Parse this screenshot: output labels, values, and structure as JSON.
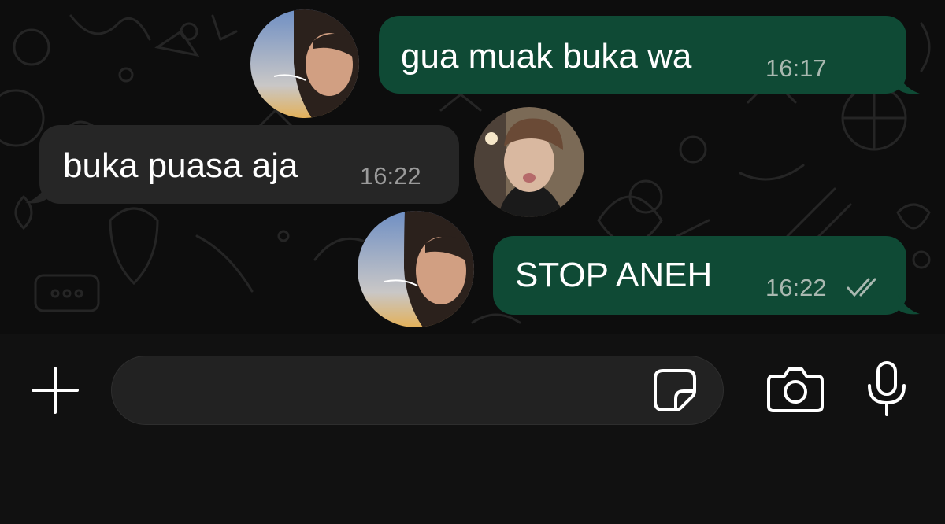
{
  "messages": [
    {
      "direction": "outgoing",
      "text": "gua muak buka wa",
      "time": "16:17",
      "status": "read"
    },
    {
      "direction": "incoming",
      "text": "buka puasa aja",
      "time": "16:22"
    },
    {
      "direction": "outgoing",
      "text": "STOP ANEH",
      "time": "16:22",
      "status": "read"
    }
  ],
  "composer": {
    "input_value": "",
    "plus_icon": "plus-icon",
    "sticker_icon": "sticker-icon",
    "camera_icon": "camera-icon",
    "mic_icon": "microphone-icon"
  },
  "colors": {
    "outgoing_bubble": "#0f4a35",
    "incoming_bubble": "#262626",
    "chat_background": "#0d0d0d",
    "composer_background": "#111111",
    "read_ticks": "#a9b8b0"
  }
}
